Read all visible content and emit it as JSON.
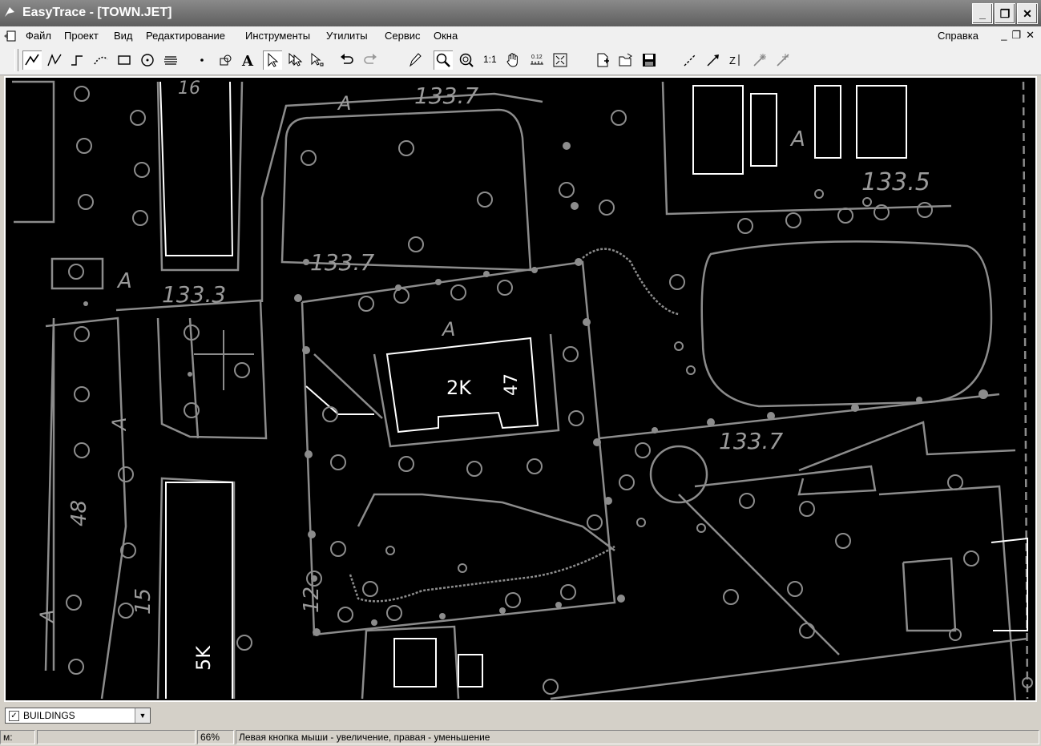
{
  "window": {
    "title": "EasyTrace - [TOWN.JET]",
    "buttons": [
      "_",
      "❐",
      "✕"
    ]
  },
  "menu": {
    "items": [
      "Файл",
      "Проект",
      "Вид",
      "Редактирование",
      "Инструменты",
      "Утилиты",
      "Сервис",
      "Окна"
    ],
    "help": "Справка",
    "mdi_buttons": [
      "_",
      "❐",
      "✕"
    ]
  },
  "toolbar": {
    "scale_label": "1:1",
    "tools": [
      "polyline-icon",
      "polygon-icon",
      "orthogonal-line-icon",
      "dashed-line-icon",
      "rectangle-icon",
      "circle-icon",
      "hatch-icon",
      "point-icon",
      "node-icon",
      "text-tool-icon",
      "select-arrow-icon",
      "multi-select-icon",
      "select-node-icon",
      "undo-icon",
      "redo-icon",
      "pencil-icon",
      "zoom-in-icon",
      "zoom-out-icon",
      "scale-1-1",
      "pan-hand-icon",
      "measure-icon",
      "fit-window-icon",
      "new-file-icon",
      "open-folder-icon",
      "save-icon",
      "line-join-icon",
      "line-extend-icon",
      "z-value-icon",
      "auto-trace-icon",
      "trace-stop-icon"
    ]
  },
  "map": {
    "labels": [
      "16",
      "133.7",
      "A",
      "133.5",
      "A",
      "133.3",
      "133.7",
      "A",
      "2K",
      "47",
      "133.7",
      "48",
      "15",
      "12",
      "A",
      "5K",
      "A",
      "A"
    ]
  },
  "layer": {
    "checked": true,
    "name": "BUILDINGS"
  },
  "status": {
    "coords": "м:",
    "empty": "",
    "zoom": "66%",
    "message": "Левая кнопка мыши - увеличение, правая - уменьшение"
  }
}
